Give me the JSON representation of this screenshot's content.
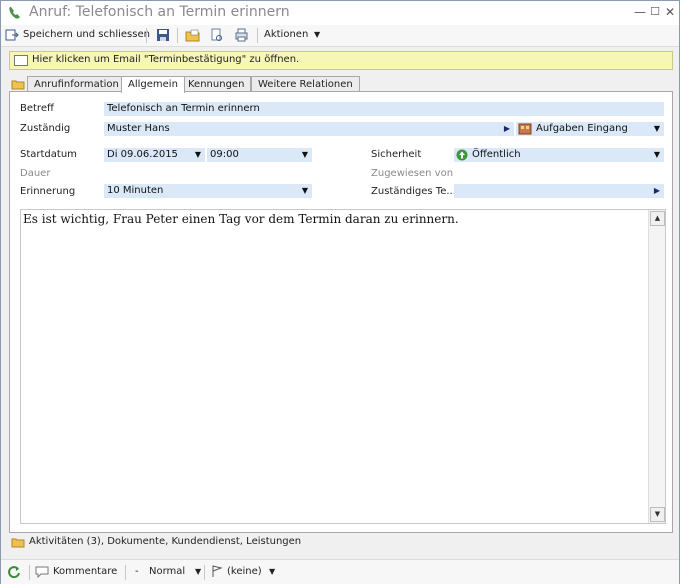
{
  "window": {
    "title": "Anruf: Telefonisch an Termin erinnern"
  },
  "toolbar": {
    "save_close_label": "Speichern und schliessen",
    "actions_label": "Aktionen"
  },
  "infobar": {
    "text": "Hier klicken um Email \"Terminbestätigung\" zu öffnen."
  },
  "tabs": [
    {
      "label": "Anrufinformation"
    },
    {
      "label": "Allgemein"
    },
    {
      "label": "Kennungen"
    },
    {
      "label": "Weitere Relationen"
    }
  ],
  "form": {
    "betreff_label": "Betreff",
    "betreff_value": "Telefonisch an Termin erinnern",
    "zustaendig_label": "Zuständig",
    "zustaendig_value": "Muster Hans",
    "queue_value": "Aufgaben Eingang",
    "startdatum_label": "Startdatum",
    "date_value": "Di 09.06.2015",
    "time_value": "09:00",
    "dauer_label": "Dauer",
    "erinnerung_label": "Erinnerung",
    "erinnerung_value": "10 Minuten",
    "sicherheit_label": "Sicherheit",
    "sicherheit_value": "Öffentlich",
    "zugewiesen_label": "Zugewiesen von",
    "zust_team_label": "Zuständiges Te..."
  },
  "editor": {
    "text": "Es ist wichtig, Frau Peter einen Tag vor dem Termin daran zu erinnern."
  },
  "related": {
    "text": "Aktivitäten (3), Dokumente, Kundendienst, Leistungen"
  },
  "statusbar": {
    "comments_label": "Kommentare",
    "priority_value": "Normal",
    "flag_value": "(keine)"
  },
  "colors": {
    "field_bg": "#dbe8f7",
    "infobar_bg": "#f6f6b5",
    "accent_green": "#3a9a3a"
  }
}
